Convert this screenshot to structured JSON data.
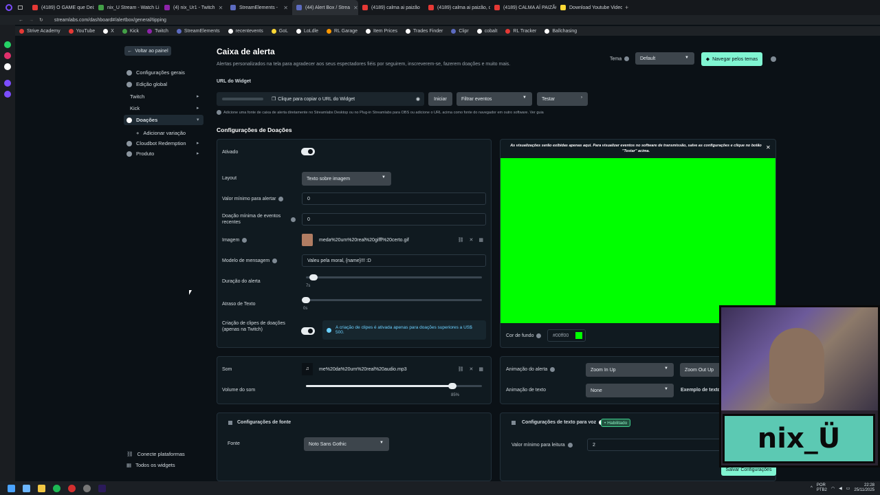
{
  "browser": {
    "tabs": [
      {
        "title": "(4189) O GAME que Deix",
        "color": "#e53935"
      },
      {
        "title": "nix_U Stream - Watch Li",
        "color": "#43a047"
      },
      {
        "title": "(4) nix_Ur1 - Twitch",
        "color": "#8e24aa"
      },
      {
        "title": "StreamElements -",
        "color": "#5c6bc0"
      },
      {
        "title": "(44) Alert Box / Strea",
        "color": "#5c6bc0"
      },
      {
        "title": "(4189) calma ai paizão",
        "color": "#e53935"
      },
      {
        "title": "(4189) calma ai paizão, c",
        "color": "#e53935"
      },
      {
        "title": "(4189) CALMA AÍ PAIZÃC",
        "color": "#e53935"
      },
      {
        "title": "Download Youtube Video",
        "color": "#fdd835"
      }
    ],
    "url": "streamlabs.com/dashboard#/alertbox/general/tipping",
    "bookmarks": [
      {
        "label": "Strive Academy",
        "color": "#e53935"
      },
      {
        "label": "YouTube",
        "color": "#e53935"
      },
      {
        "label": "X",
        "color": "#ffffff"
      },
      {
        "label": "Kick",
        "color": "#43a047"
      },
      {
        "label": "Twitch",
        "color": "#8e24aa"
      },
      {
        "label": "StreamElements",
        "color": "#5c6bc0"
      },
      {
        "label": "recentevents",
        "color": "#ffffff"
      },
      {
        "label": "GoL",
        "color": "#fdd835"
      },
      {
        "label": "LoLdle",
        "color": "#ffffff"
      },
      {
        "label": "RL Garage",
        "color": "#ff9800"
      },
      {
        "label": "Item Prices",
        "color": "#ffffff"
      },
      {
        "label": "Trades Finder",
        "color": "#ffffff"
      },
      {
        "label": "Clipr",
        "color": "#5c6bc0"
      },
      {
        "label": "cobalt",
        "color": "#ffffff"
      },
      {
        "label": "RL Tracker",
        "color": "#e53935"
      },
      {
        "label": "Ballchasing",
        "color": "#ffffff"
      }
    ]
  },
  "sidebar": {
    "back": "Voltar ao painel",
    "items": [
      {
        "label": "Configurações gerais"
      },
      {
        "label": "Edição global"
      },
      {
        "label": "Twitch"
      },
      {
        "label": "Kick"
      },
      {
        "label": "Doações"
      },
      {
        "label": "Adicionar variação"
      },
      {
        "label": "Cloudbot Redemption"
      },
      {
        "label": "Produto"
      }
    ],
    "bottom": [
      "Conecte plataformas",
      "Todos os widgets"
    ]
  },
  "header": {
    "title": "Caixa de alerta",
    "subtitle": "Alertas personalizados na tela para agradecer aos seus espectadores fiéis por seguirem, inscreverem-se, fazerem doações e muito mais.",
    "theme_label": "Tema",
    "theme_value": "Default",
    "browse_themes": "Navegar pelos temas"
  },
  "widget": {
    "url_label": "URL do Widget",
    "copy_label": "Clique para copiar o URL do Widget",
    "start": "Iniciar",
    "filter": "Filtrar eventos",
    "test": "Testar",
    "note": "Adicione uma fonte de caixa de alerta diretamente no Streamlabs Desktop ou no Plug-in Streamlabs para OBS ou adicione o URL acima como fonte do navegador em outro software. Ver guia"
  },
  "donations": {
    "section_title": "Configurações de Doações",
    "enabled_label": "Ativado",
    "layout_label": "Layout",
    "layout_value": "Texto sobre imagem",
    "min_alert_label": "Valor mínimo para alertar",
    "min_alert_value": "0",
    "min_recent_label": "Doação mínima de eventos recentes",
    "min_recent_value": "0",
    "image_label": "Imagem",
    "image_file": "meda%20um%20real%20gifff%20certo.gif",
    "message_label": "Modelo de mensagem",
    "message_value": "Valeu pela moral, {name}!!! :D",
    "duration_label": "Duração do alerta",
    "duration_value": "7s",
    "duration_fraction": 0.02,
    "text_delay_label": "Atraso de Texto",
    "text_delay_value": "0s",
    "text_delay_fraction": 0.0,
    "clips_label": "Criação de clipes de doações (apenas na Twitch)",
    "clips_note": "A criação de clipes é ativada apenas para doações superiores a US$ 500."
  },
  "preview": {
    "notice": "As visualizações serão exibidas apenas aqui. Para visualizar eventos no software de transmissão, salve as configurações e clique no botão \"Testar\" acima.",
    "bg_label": "Cor de fundo",
    "bg_value": "#00ff00",
    "bg_color": "#00ff00"
  },
  "sound": {
    "label": "Som",
    "file": "me%20da%20um%20real%20audio.mp3",
    "volume_label": "Volume do som",
    "volume_value": "85%",
    "volume_fraction": 0.85
  },
  "animation": {
    "alert_label": "Animação do alerta",
    "alert_in": "Zoom In Up",
    "alert_out": "Zoom Out Up",
    "text_label": "Animação de texto",
    "text_value": "None",
    "text_example": "Exemplo de texto"
  },
  "font": {
    "section": "Configurações de fonte",
    "font_label": "Fonte",
    "font_value": "Noto Sans Gothic"
  },
  "tts": {
    "section": "Configurações de texto para voz",
    "badge": "Habilitado",
    "min_label": "Valor mínimo para leitura",
    "min_value": "2"
  },
  "save_button": "Salvar Configurações",
  "webcam": {
    "overlay_text": "nix_Ü"
  },
  "taskbar": {
    "lang": "POR",
    "lang2": "PTB2",
    "time": "22:28",
    "date": "25/11/2025"
  }
}
